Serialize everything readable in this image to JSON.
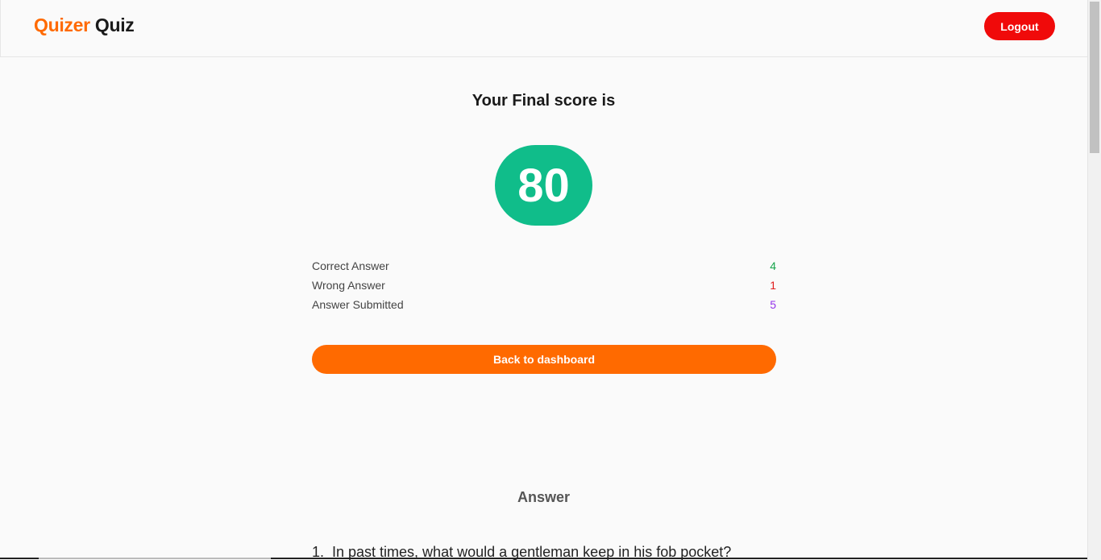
{
  "header": {
    "brand_first": "Quizer",
    "brand_second": "Quiz",
    "logout_label": "Logout"
  },
  "result": {
    "title": "Your Final score is",
    "score": "80",
    "stats": [
      {
        "label": "Correct Answer",
        "value": "4"
      },
      {
        "label": "Wrong Answer",
        "value": "1"
      },
      {
        "label": "Answer Submitted",
        "value": "5"
      }
    ],
    "back_label": "Back to dashboard"
  },
  "answers": {
    "heading": "Answer",
    "questions": [
      {
        "number": "1.",
        "text": "In past times, what would a gentleman keep in his fob pocket?"
      }
    ]
  },
  "colors": {
    "brand_accent": "#ff6a00",
    "logout": "#f00a0a",
    "score_circle": "#10bd8a",
    "correct": "#16a34a",
    "wrong": "#e11d1d",
    "submitted": "#9333ea"
  }
}
